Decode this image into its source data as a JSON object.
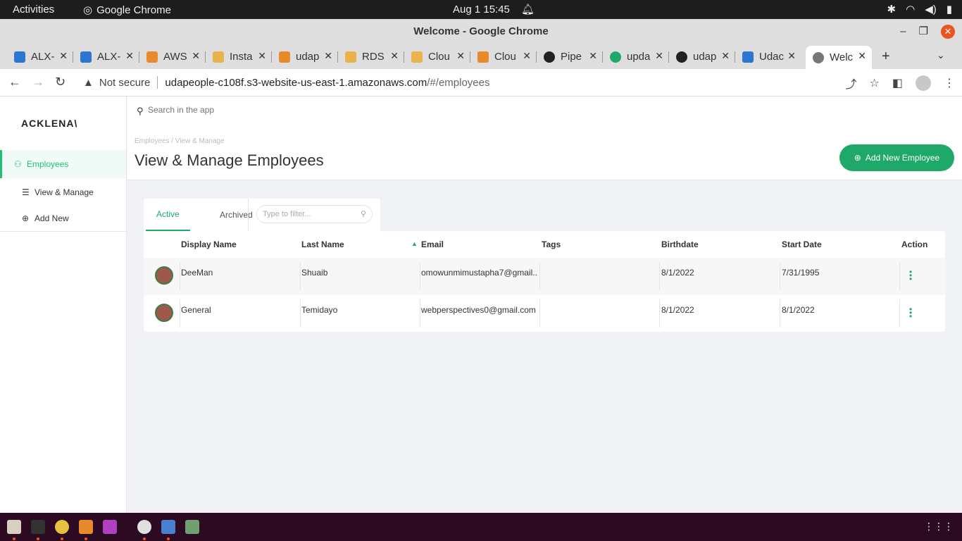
{
  "system": {
    "activities": "Activities",
    "app_name": "Google Chrome",
    "clock": "Aug 1  15:45"
  },
  "window": {
    "title": "Welcome - Google Chrome"
  },
  "tabs": [
    {
      "label": "ALX-",
      "color": "#2a76d2"
    },
    {
      "label": "ALX-",
      "color": "#2a76d2"
    },
    {
      "label": "AWS",
      "color": "#e88a2a"
    },
    {
      "label": "Insta",
      "color": "#e8b34a"
    },
    {
      "label": "udap",
      "color": "#e88a2a"
    },
    {
      "label": "RDS",
      "color": "#e8b34a"
    },
    {
      "label": "Clou",
      "color": "#e8b34a"
    },
    {
      "label": "Clou",
      "color": "#e88a2a"
    },
    {
      "label": "Pipe",
      "color": "#222222"
    },
    {
      "label": "upda",
      "color": "#1fa968"
    },
    {
      "label": "udap",
      "color": "#222222"
    },
    {
      "label": "Udac",
      "color": "#2a76d2"
    },
    {
      "label": "Welc",
      "color": "#777777"
    }
  ],
  "address": {
    "security": "Not secure",
    "host": "udapeople-c108f.s3-website-us-east-1.amazonaws.com",
    "path": "/#/employees"
  },
  "sidebar": {
    "logo": "ACKLENA\\",
    "items": [
      {
        "label": "Employees"
      },
      {
        "label": "View & Manage"
      },
      {
        "label": "Add New"
      }
    ]
  },
  "search": {
    "placeholder": "Search in the app"
  },
  "header": {
    "breadcrumb": "Employees   /   View & Manage",
    "title": "View & Manage Employees",
    "add_button": "Add New Employee"
  },
  "filter_tabs": {
    "active": "Active",
    "archived": "Archived",
    "filter_placeholder": "Type to filter..."
  },
  "table": {
    "columns": [
      "Display Name",
      "Last Name",
      "Email",
      "Tags",
      "Birthdate",
      "Start Date",
      "Action"
    ],
    "rows": [
      {
        "display_name": "DeeMan",
        "last_name": "Shuaib",
        "email": "omowunmimustapha7@gmail....",
        "tags": "",
        "birthdate": "8/1/2022",
        "start_date": "7/31/1995"
      },
      {
        "display_name": "General",
        "last_name": "Temidayo",
        "email": "webperspectives0@gmail.com",
        "tags": "",
        "birthdate": "8/1/2022",
        "start_date": "8/1/2022"
      }
    ]
  },
  "colors": {
    "accent": "#1fa968",
    "taskbar": "#2c0b22"
  }
}
